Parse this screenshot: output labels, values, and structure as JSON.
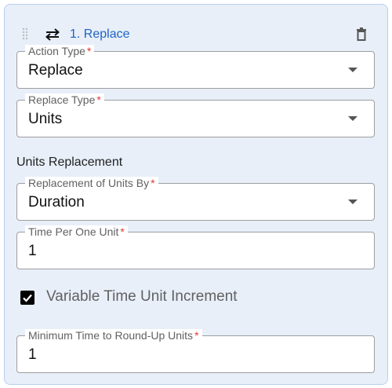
{
  "header": {
    "title": "1. Replace",
    "drag_icon": "drag-handle-icon",
    "swap_icon": "swap-arrows-icon",
    "delete_icon": "trash-icon"
  },
  "fields": {
    "action_type": {
      "label": "Action Type",
      "required_mark": "*",
      "value": "Replace"
    },
    "replace_type": {
      "label": "Replace Type",
      "required_mark": "*",
      "value": "Units"
    },
    "replacement_by": {
      "label": "Replacement of Units By",
      "required_mark": "*",
      "value": "Duration"
    },
    "time_per_unit": {
      "label": "Time Per One Unit",
      "required_mark": "*",
      "value": "1"
    },
    "min_round_up": {
      "label": "Minimum Time to Round-Up Units",
      "required_mark": "*",
      "value": "1"
    }
  },
  "section": {
    "units_replacement": "Units Replacement"
  },
  "checkbox": {
    "label": "Variable Time Unit Increment",
    "checked": true
  },
  "colors": {
    "card_background": "#e8eff9",
    "card_border": "#b9d0ee",
    "title_link": "#1e63c4",
    "required": "#e53935"
  }
}
